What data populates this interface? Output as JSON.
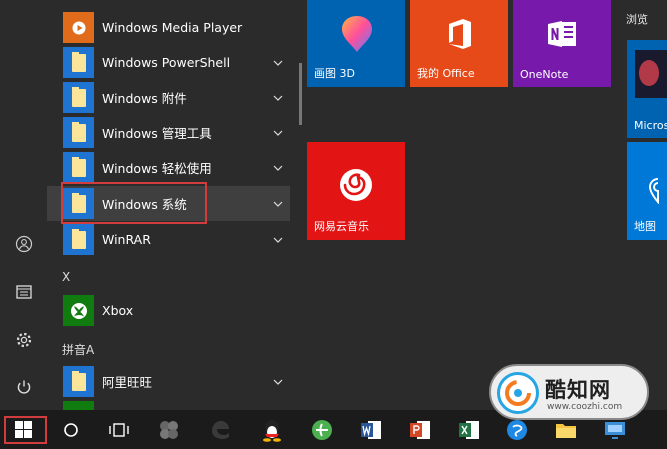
{
  "rail": {
    "items": [
      {
        "icon": "user-icon"
      },
      {
        "icon": "documents-icon"
      },
      {
        "icon": "settings-icon"
      },
      {
        "icon": "power-icon"
      }
    ]
  },
  "apps": {
    "top_item": {
      "label": "Windows Media Player"
    },
    "folders": [
      {
        "label": "Windows PowerShell"
      },
      {
        "label": "Windows 附件"
      },
      {
        "label": "Windows 管理工具"
      },
      {
        "label": "Windows 轻松使用"
      },
      {
        "label": "Windows 系统"
      },
      {
        "label": "WinRAR"
      }
    ],
    "section_x": "X",
    "xbox": {
      "label": "Xbox"
    },
    "section_pinyin": "拼音A",
    "alibaba": {
      "label": "阿里旺旺"
    }
  },
  "tiles": {
    "paint3d": {
      "label": "画图 3D",
      "color": "#0063b1"
    },
    "office": {
      "label": "我的 Office",
      "color": "#e64a19"
    },
    "onenote": {
      "label": "OneNote",
      "color": "#7719aa"
    },
    "netease": {
      "label": "网易云音乐",
      "color": "#e31414"
    },
    "browse_section": "浏览",
    "store": {
      "label": "Micros",
      "color": "#0063b1"
    },
    "maps": {
      "label": "地图",
      "color": "#0078d7"
    }
  },
  "taskbar": {
    "icons": [
      "windows-start-icon",
      "search-circle-icon",
      "task-view-icon",
      "app-icon",
      "edge-icon",
      "qq-icon",
      "browser-icon",
      "word-icon",
      "powerpoint-icon",
      "excel-icon",
      "browser2-icon",
      "file-explorer-icon",
      "remote-icon"
    ]
  },
  "watermark": {
    "title": "酷知网",
    "url": "www.coozhi.com"
  },
  "colors": {
    "accent": "#1e74d0",
    "highlight_border": "#d33c3c",
    "folder": "#fbe59a"
  }
}
